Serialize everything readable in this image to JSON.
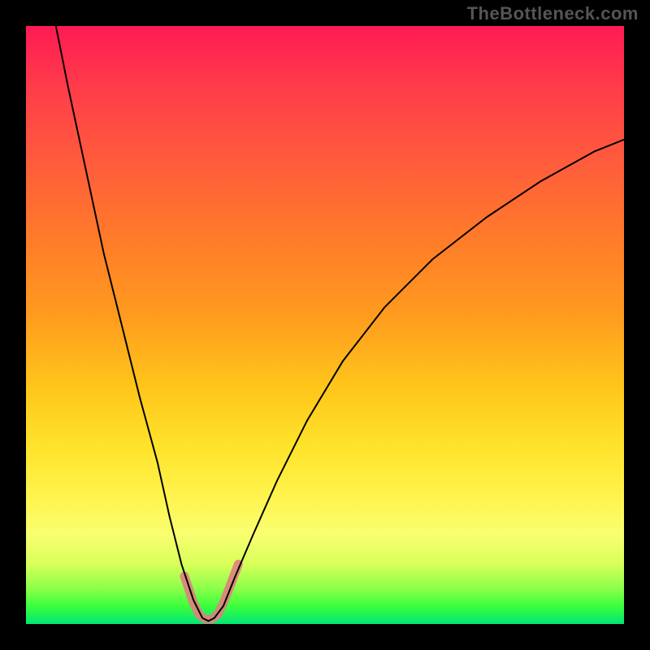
{
  "watermark": "TheBottleneck.com",
  "chart_data": {
    "type": "line",
    "title": "",
    "xlabel": "",
    "ylabel": "",
    "xlim": [
      0,
      100
    ],
    "ylim": [
      0,
      100
    ],
    "series": [
      {
        "name": "bottleneck-curve",
        "color": "#000000",
        "stroke_width": 2,
        "x": [
          5,
          7,
          10,
          13,
          16,
          19,
          22,
          24,
          26,
          28,
          29.5,
          30.5,
          31.5,
          33,
          35,
          38,
          42,
          47,
          53,
          60,
          68,
          77,
          86,
          95,
          100
        ],
        "y": [
          100,
          90,
          76,
          62,
          50,
          38,
          27,
          18,
          10,
          4,
          1,
          0.5,
          1,
          3,
          8,
          15,
          24,
          34,
          44,
          53,
          61,
          68,
          74,
          79,
          81
        ]
      },
      {
        "name": "highlight-u",
        "color": "#e08080",
        "stroke_width": 11,
        "opacity": 0.9,
        "linecap": "round",
        "x": [
          26.5,
          28,
          29,
          30,
          31,
          32,
          33,
          34,
          35.5
        ],
        "y": [
          8,
          3.5,
          1.5,
          0.8,
          0.8,
          1.5,
          3.5,
          6,
          10
        ]
      }
    ],
    "gradient_colors": {
      "top": "#ff1a53",
      "upper_mid": "#ff7a2a",
      "mid": "#ffe22a",
      "lower_mid": "#d8ff5a",
      "bottom": "#00e676"
    }
  }
}
